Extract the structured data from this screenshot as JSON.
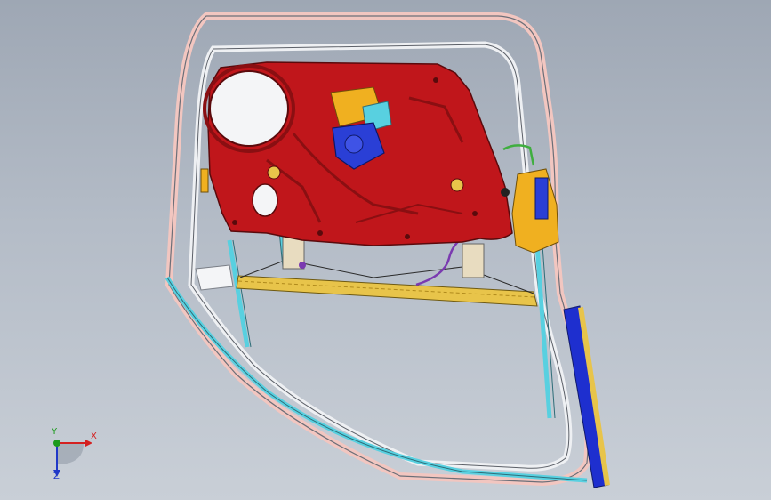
{
  "viewport": {
    "background_top": "#9ea7b4",
    "background_bottom": "#c9cfd7"
  },
  "model": {
    "name": "door-assembly",
    "colors": {
      "inner_panel": "#c0161b",
      "panel_dark": "#8a0f12",
      "motor_bracket": "#f0b020",
      "motor_housing": "#2a3fd6",
      "frame_outer": "#f2c6c0",
      "frame_inner": "#eef0f3",
      "channel_cyan": "#58d0e0",
      "glass_rail": "#e8c44a",
      "blue_trim": "#1e2fcf",
      "cable_purple": "#7a3ab0",
      "cable_green": "#3fae3f"
    }
  },
  "triad": {
    "x_label": "X",
    "y_label": "Y",
    "z_label": "Z",
    "x_color": "#d42020",
    "y_color": "#1c9a1c",
    "z_color": "#2038c8"
  }
}
